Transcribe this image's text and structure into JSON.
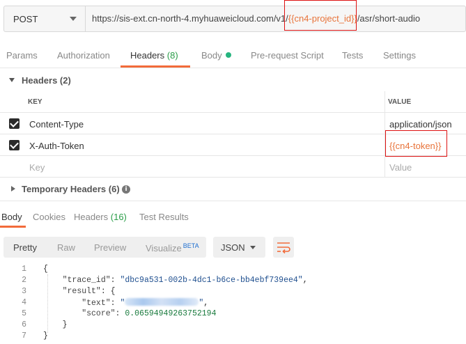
{
  "request": {
    "method": "POST",
    "url_prefix": "https://sis-ext.cn-north-4.myhuaweicloud.com/v1/",
    "url_var": "{{cn4-project_id}}",
    "url_suffix": "/asr/short-audio"
  },
  "request_tabs": {
    "params": "Params",
    "authorization": "Authorization",
    "headers_label": "Headers",
    "headers_count": "(8)",
    "body": "Body",
    "prerequest": "Pre-request Script",
    "tests": "Tests",
    "settings": "Settings"
  },
  "headers_section": {
    "title": "Headers (2)",
    "col_key": "KEY",
    "col_value": "VALUE",
    "rows": [
      {
        "checked": true,
        "key": "Content-Type",
        "value": "application/json"
      },
      {
        "checked": true,
        "key": "X-Auth-Token",
        "value": "{{cn4-token}}"
      }
    ],
    "key_placeholder": "Key",
    "value_placeholder": "Value"
  },
  "temp_headers": {
    "title": "Temporary Headers (6)"
  },
  "response_tabs": {
    "body": "Body",
    "cookies": "Cookies",
    "headers_label": "Headers",
    "headers_count": "(16)",
    "test_results": "Test Results"
  },
  "response_toolbar": {
    "pretty": "Pretty",
    "raw": "Raw",
    "preview": "Preview",
    "visualize": "Visualize",
    "beta": "BETA",
    "language": "JSON"
  },
  "response_body": {
    "line_numbers": [
      "1",
      "2",
      "3",
      "4",
      "5",
      "6",
      "7"
    ],
    "open_brace": "{",
    "trace_id_key": "\"trace_id\"",
    "trace_id_value": "\"dbc9a531-002b-4dc1-b6ce-bb4ebf739ee4\"",
    "result_key": "\"result\"",
    "text_key": "\"text\"",
    "score_key": "\"score\"",
    "score_value": "0.06594949263752194",
    "inner_close": "}",
    "close_brace": "}"
  },
  "colors": {
    "accent": "#f26b3a",
    "variable": "#e8733a",
    "count_green": "#2a9d48",
    "highlight_red": "#dd1111"
  }
}
